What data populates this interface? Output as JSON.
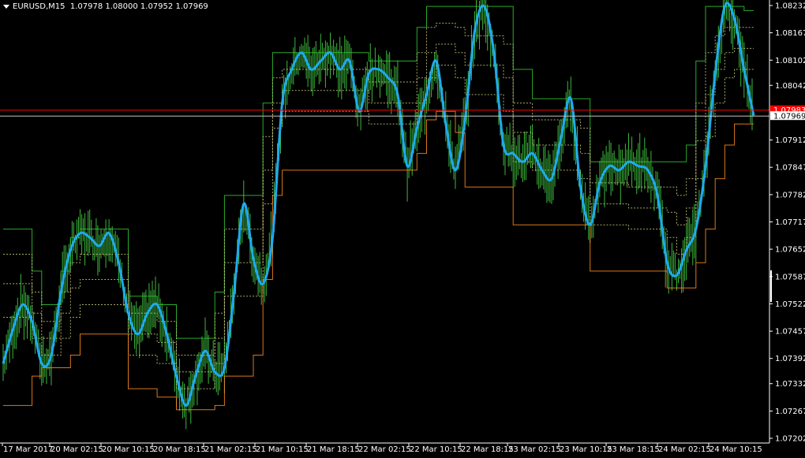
{
  "header": {
    "symbol": "EURUSD,M15",
    "ohlc": "1.07978 1.08000 1.07952 1.07969"
  },
  "colors": {
    "background": "#000000",
    "axis": "#ffffff",
    "candles": "#3cb83c",
    "main_line": "#1eaaf0",
    "upper_band": "#32c832",
    "lower_band": "#ff8c1e",
    "inner_bands": "#c8c87a",
    "bid_line": "#ff0000",
    "price_line": "#c0c0c0"
  },
  "chart_data": {
    "type": "line",
    "title": "EURUSD,M15",
    "x_tick_labels": [
      "17 Mar 2017",
      "20 Mar 02:15",
      "20 Mar 10:15",
      "20 Mar 18:15",
      "21 Mar 02:15",
      "21 Mar 10:15",
      "21 Mar 18:15",
      "22 Mar 02:15",
      "22 Mar 10:15",
      "22 Mar 18:15",
      "23 Mar 02:15",
      "23 Mar 10:15",
      "23 Mar 18:15",
      "24 Mar 02:15",
      "24 Mar 10:15"
    ],
    "y_tick_labels": [
      "1.08232",
      "1.08167",
      "1.08102",
      "1.08042",
      "1.07912",
      "1.07847",
      "1.07782",
      "1.07717",
      "1.07652",
      "1.07587",
      "1.07522",
      "1.07457",
      "1.07392",
      "1.07332",
      "1.07267",
      "1.07202"
    ],
    "ylim": [
      1.07202,
      1.08232
    ],
    "current_price": "1.07969",
    "bid_price": "1.07983",
    "series": [
      {
        "role": "main",
        "values": [
          1.0738,
          1.0746,
          1.0752,
          1.0748,
          1.0738,
          1.074,
          1.0755,
          1.0765,
          1.0769,
          1.0768,
          1.0766,
          1.0769,
          1.0762,
          1.075,
          1.0745,
          1.075,
          1.0752,
          1.0745,
          1.0735,
          1.0728,
          1.0735,
          1.0741,
          1.0736,
          1.0737,
          1.0755,
          1.0776,
          1.0763,
          1.0757,
          1.0768,
          1.08,
          1.0808,
          1.0812,
          1.0808,
          1.081,
          1.0812,
          1.0808,
          1.081,
          1.0798,
          1.0807,
          1.0808,
          1.0806,
          1.0802,
          1.0785,
          1.0794,
          1.0802,
          1.081,
          1.0795,
          1.0784,
          1.0796,
          1.0817,
          1.0823,
          1.0812,
          1.079,
          1.0788,
          1.0786,
          1.0788,
          1.0784,
          1.0782,
          1.0792,
          1.0801,
          1.078,
          1.0771,
          1.0781,
          1.0785,
          1.0784,
          1.0786,
          1.0785,
          1.0784,
          1.0778,
          1.0762,
          1.0759,
          1.0765,
          1.077,
          1.0785,
          1.0807,
          1.0823,
          1.082,
          1.0808,
          1.0797
        ]
      },
      {
        "role": "upper_band",
        "values": [
          1.077,
          1.077,
          1.077,
          1.076,
          1.0752,
          1.0752,
          1.076,
          1.0768,
          1.077,
          1.077,
          1.077,
          1.077,
          1.077,
          1.0754,
          1.0754,
          1.0754,
          1.0752,
          1.0752,
          1.0744,
          1.0744,
          1.0744,
          1.0744,
          1.0755,
          1.0778,
          1.0778,
          1.0778,
          1.0778,
          1.08,
          1.0812,
          1.0812,
          1.0812,
          1.0812,
          1.0812,
          1.0812,
          1.0812,
          1.0812,
          1.0812,
          1.0812,
          1.081,
          1.081,
          1.081,
          1.081,
          1.081,
          1.0818,
          1.0823,
          1.0823,
          1.0823,
          1.0823,
          1.0823,
          1.0823,
          1.0823,
          1.0823,
          1.0823,
          1.0808,
          1.0808,
          1.0801,
          1.0801,
          1.0801,
          1.0801,
          1.0801,
          1.0801,
          1.0786,
          1.0786,
          1.0786,
          1.0786,
          1.0786,
          1.0786,
          1.0786,
          1.0786,
          1.0786,
          1.0786,
          1.079,
          1.081,
          1.0823,
          1.0823,
          1.0823,
          1.0823,
          1.0822,
          1.0822
        ]
      },
      {
        "role": "inner_upper",
        "values": [
          1.0764,
          1.0764,
          1.0764,
          1.0755,
          1.0748,
          1.0748,
          1.0755,
          1.0762,
          1.0764,
          1.0764,
          1.0764,
          1.0764,
          1.0764,
          1.075,
          1.075,
          1.075,
          1.0748,
          1.0748,
          1.074,
          1.074,
          1.074,
          1.074,
          1.075,
          1.077,
          1.077,
          1.077,
          1.077,
          1.0792,
          1.0806,
          1.0808,
          1.0808,
          1.0808,
          1.0808,
          1.0808,
          1.0808,
          1.0808,
          1.0808,
          1.0808,
          1.0805,
          1.0805,
          1.0805,
          1.0805,
          1.0805,
          1.0812,
          1.0818,
          1.0819,
          1.0819,
          1.0818,
          1.0816,
          1.0816,
          1.0816,
          1.0816,
          1.0814,
          1.08,
          1.08,
          1.0796,
          1.0796,
          1.0796,
          1.0796,
          1.0796,
          1.0794,
          1.0781,
          1.0781,
          1.0781,
          1.0781,
          1.078,
          1.078,
          1.078,
          1.078,
          1.078,
          1.0778,
          1.0782,
          1.08,
          1.0812,
          1.0816,
          1.0818,
          1.0818,
          1.0818,
          1.0818
        ]
      },
      {
        "role": "inner_mid",
        "values": [
          1.0757,
          1.0757,
          1.0757,
          1.075,
          1.0744,
          1.0744,
          1.075,
          1.0756,
          1.0758,
          1.0758,
          1.0758,
          1.0758,
          1.0758,
          1.0745,
          1.0745,
          1.0745,
          1.0743,
          1.0743,
          1.0736,
          1.0736,
          1.0736,
          1.0736,
          1.0744,
          1.0762,
          1.0762,
          1.0762,
          1.0762,
          1.0784,
          1.08,
          1.0803,
          1.0803,
          1.0803,
          1.0803,
          1.0803,
          1.0803,
          1.0803,
          1.0803,
          1.0803,
          1.08,
          1.08,
          1.08,
          1.08,
          1.08,
          1.0806,
          1.0812,
          1.0814,
          1.0814,
          1.0812,
          1.0809,
          1.0809,
          1.0809,
          1.0809,
          1.0806,
          1.0793,
          1.0793,
          1.079,
          1.079,
          1.079,
          1.079,
          1.079,
          1.0788,
          1.0776,
          1.0776,
          1.0776,
          1.0776,
          1.0775,
          1.0775,
          1.0775,
          1.0775,
          1.0774,
          1.0771,
          1.0775,
          1.0791,
          1.0802,
          1.0808,
          1.0812,
          1.0813,
          1.0813,
          1.0813
        ]
      },
      {
        "role": "inner_lower",
        "values": [
          1.0749,
          1.0749,
          1.0749,
          1.0744,
          1.074,
          1.074,
          1.0744,
          1.0749,
          1.0752,
          1.0752,
          1.0752,
          1.0752,
          1.0752,
          1.074,
          1.074,
          1.074,
          1.0738,
          1.0738,
          1.0732,
          1.0732,
          1.0732,
          1.0732,
          1.0738,
          1.0754,
          1.0754,
          1.0754,
          1.0754,
          1.0776,
          1.0794,
          1.0798,
          1.0798,
          1.0798,
          1.0798,
          1.0798,
          1.0798,
          1.0798,
          1.0798,
          1.0798,
          1.0795,
          1.0795,
          1.0795,
          1.0795,
          1.0795,
          1.08,
          1.0806,
          1.0809,
          1.0809,
          1.0806,
          1.0802,
          1.0802,
          1.0802,
          1.0802,
          1.0798,
          1.0786,
          1.0786,
          1.0784,
          1.0784,
          1.0784,
          1.0784,
          1.0784,
          1.0782,
          1.0771,
          1.0771,
          1.0771,
          1.0771,
          1.077,
          1.077,
          1.077,
          1.077,
          1.0768,
          1.0764,
          1.0768,
          1.0782,
          1.0792,
          1.08,
          1.0806,
          1.0808,
          1.0808,
          1.0808
        ]
      },
      {
        "role": "lower_band",
        "values": [
          1.0728,
          1.0728,
          1.0728,
          1.0735,
          1.0737,
          1.0737,
          1.0737,
          1.074,
          1.0745,
          1.0745,
          1.0745,
          1.0745,
          1.0745,
          1.0732,
          1.0732,
          1.0732,
          1.073,
          1.073,
          1.0727,
          1.0727,
          1.0727,
          1.0727,
          1.0728,
          1.0735,
          1.0735,
          1.0735,
          1.074,
          1.0758,
          1.0778,
          1.0784,
          1.0784,
          1.0784,
          1.0784,
          1.0784,
          1.0784,
          1.0784,
          1.0784,
          1.0784,
          1.0784,
          1.0784,
          1.0784,
          1.0784,
          1.0784,
          1.0788,
          1.0796,
          1.0798,
          1.0798,
          1.0793,
          1.078,
          1.078,
          1.078,
          1.078,
          1.078,
          1.0771,
          1.0771,
          1.0771,
          1.0771,
          1.0771,
          1.0771,
          1.0771,
          1.0771,
          1.076,
          1.076,
          1.076,
          1.076,
          1.076,
          1.076,
          1.076,
          1.076,
          1.0756,
          1.0756,
          1.0756,
          1.0762,
          1.077,
          1.0782,
          1.079,
          1.0795,
          1.0795,
          1.0795
        ]
      }
    ]
  }
}
